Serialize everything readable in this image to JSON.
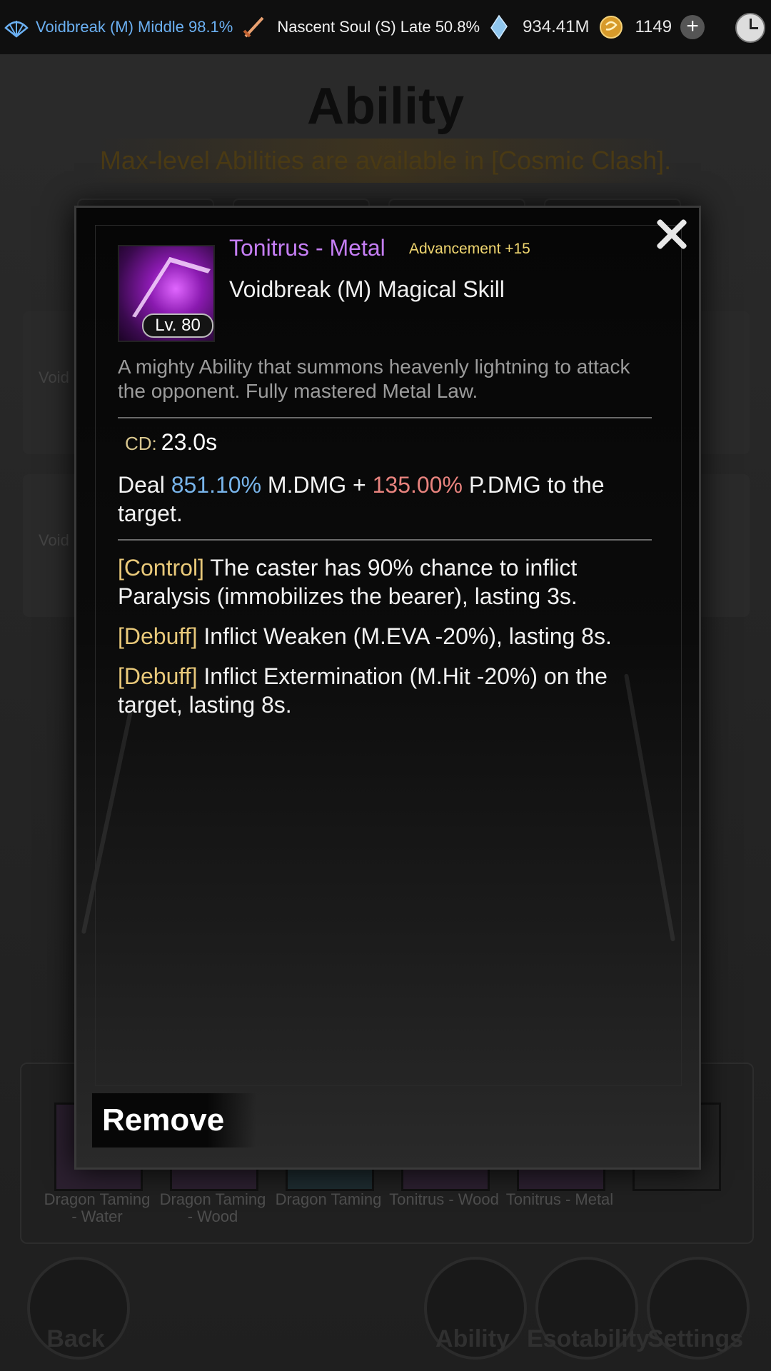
{
  "topbar": {
    "realm": "Voidbreak (M) Middle 98.1%",
    "soul": "Nascent Soul (S) Late 50.8%",
    "spirit_stones": "934.41M",
    "gold": "1149",
    "plus": "+"
  },
  "background": {
    "title": "Ability",
    "subtitle": "Max-level Abilities are available in [Cosmic Clash].",
    "card_text_1": "Void",
    "card_text_2": "Void",
    "slots": [
      {
        "label": "Dragon Taming - Water"
      },
      {
        "label": "Dragon Taming - Wood"
      },
      {
        "label": "Dragon Taming"
      },
      {
        "label": "Tonitrus - Wood"
      },
      {
        "label": "Tonitrus - Metal"
      }
    ],
    "nav": {
      "back": "Back",
      "ability": "Ability",
      "esotability": "Esotability",
      "settings": "Settings"
    }
  },
  "modal": {
    "skill_name": "Tonitrus - Metal",
    "advancement": "Advancement +15",
    "skill_type": "Voidbreak (M) Magical Skill",
    "level": "Lv. 80",
    "description": "A mighty Ability that summons heavenly lightning to attack the opponent. Fully mastered Metal Law.",
    "cd_label": "CD:",
    "cd_value": "23.0s",
    "damage": {
      "prefix": "Deal ",
      "mdmg_value": "851.10%",
      "mdmg_text": " M.DMG + ",
      "pdmg_value": "135.00%",
      "pdmg_text": " P.DMG to the target."
    },
    "effects": [
      {
        "tag": "[Control]",
        "text": " The caster has 90% chance to inflict Paralysis (immobilizes the bearer), lasting 3s."
      },
      {
        "tag": "[Debuff]",
        "text": " Inflict Weaken (M.EVA -20%), lasting 8s."
      },
      {
        "tag": "[Debuff]",
        "text": " Inflict Extermination (M.Hit -20%) on the target, lasting 8s."
      }
    ],
    "remove_label": "Remove"
  },
  "colors": {
    "skill_name": "#c57ef4",
    "advancement": "#f0d670",
    "mdmg": "#78b4ea",
    "pdmg": "#e8837e",
    "effect_tag": "#e9c97a",
    "realm": "#6bb0f2"
  },
  "icons": [
    "realm-fan-icon",
    "sword-icon",
    "spirit-stone-icon",
    "gold-coin-icon",
    "plus-icon",
    "clock-icon",
    "close-icon"
  ]
}
